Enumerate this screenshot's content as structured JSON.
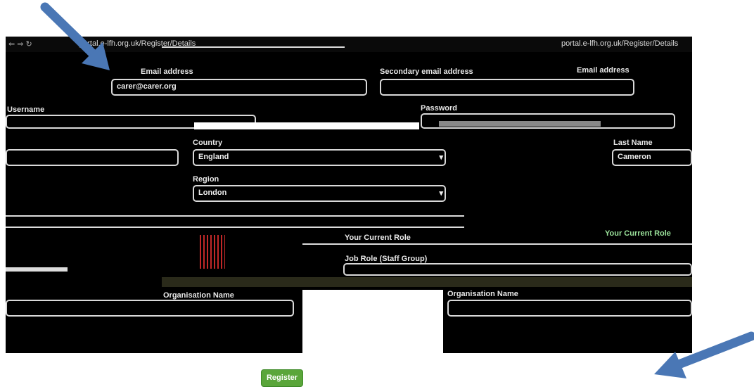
{
  "browser": {
    "url_left": "portal.e-lfh.org.uk/Register/Details",
    "url_right": "portal.e-lfh.org.uk/Register/Details"
  },
  "form": {
    "email_label": "Email address",
    "secondary_email_label": "Secondary email address",
    "email_value": "carer@carer.org",
    "username_label": "Username",
    "password_label": "Password",
    "country_label": "Country",
    "country_value": "England",
    "region_label": "Region",
    "region_value": "London",
    "lastname_label": "Last Name",
    "lastname_value": "Cameron",
    "current_role_label": "Your Current Role",
    "job_role_label": "Job Role (Staff Group)",
    "org_name_label": "Organisation Name",
    "register_button": "Register"
  },
  "colors": {
    "arrow": "#4a77b5",
    "button": "#5aa63a"
  }
}
